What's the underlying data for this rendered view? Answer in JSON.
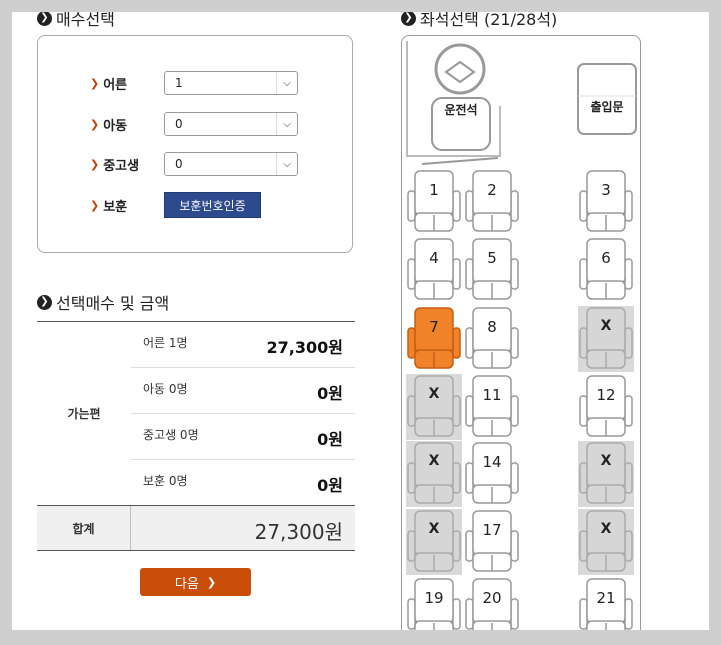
{
  "ticket_section": {
    "title": "매수선택"
  },
  "ticket_rows": [
    {
      "label": "어른",
      "value": "1"
    },
    {
      "label": "아동",
      "value": "0"
    },
    {
      "label": "중고생",
      "value": "0"
    }
  ],
  "veteran": {
    "label": "보훈",
    "button": "보훈번호인증"
  },
  "summary_section": {
    "title": "선택매수 및 금액"
  },
  "summary": {
    "route": "가는편",
    "rows": [
      {
        "label": "어른 1명",
        "amount": "27,300원"
      },
      {
        "label": "아동 0명",
        "amount": "0원"
      },
      {
        "label": "중고생 0명",
        "amount": "0원"
      },
      {
        "label": "보훈 0명",
        "amount": "0원"
      }
    ],
    "total_label": "합계",
    "total_amount": "27,300원"
  },
  "next_button": {
    "label": "다음"
  },
  "seat_section": {
    "title": "좌석선택 (21/28석)"
  },
  "bus": {
    "driver_label": "운전석",
    "door_label": "출입문"
  },
  "seats": [
    {
      "label": "1",
      "status": "available"
    },
    {
      "label": "2",
      "status": "available"
    },
    {
      "label": "3",
      "status": "available"
    },
    {
      "label": "4",
      "status": "available"
    },
    {
      "label": "5",
      "status": "available"
    },
    {
      "label": "6",
      "status": "available"
    },
    {
      "label": "7",
      "status": "selected"
    },
    {
      "label": "8",
      "status": "available"
    },
    {
      "label": "X",
      "status": "sold"
    },
    {
      "label": "X",
      "status": "sold"
    },
    {
      "label": "11",
      "status": "available"
    },
    {
      "label": "12",
      "status": "available"
    },
    {
      "label": "X",
      "status": "sold"
    },
    {
      "label": "14",
      "status": "available"
    },
    {
      "label": "X",
      "status": "sold"
    },
    {
      "label": "X",
      "status": "sold"
    },
    {
      "label": "17",
      "status": "available"
    },
    {
      "label": "X",
      "status": "sold"
    },
    {
      "label": "19",
      "status": "available"
    },
    {
      "label": "20",
      "status": "available"
    },
    {
      "label": "21",
      "status": "available"
    }
  ],
  "colors": {
    "selected_seat": "#f0822a",
    "sold_seat": "#d9d9d9",
    "accent_button": "#c84e0a",
    "verify_button": "#2e4a8e"
  }
}
